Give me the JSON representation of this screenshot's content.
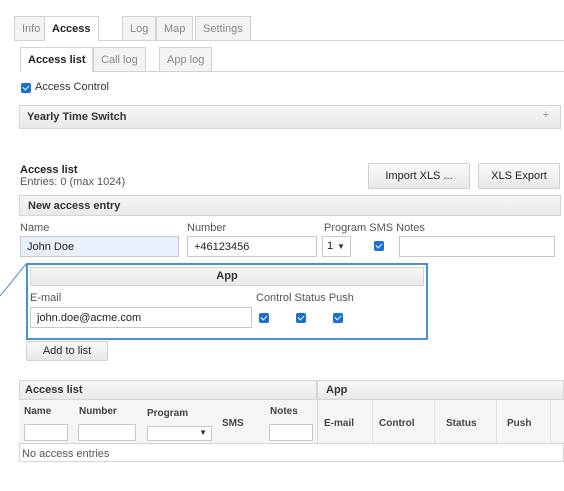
{
  "tabs": [
    {
      "label": "Info"
    },
    {
      "label": "Access"
    },
    {
      "label": "Log"
    },
    {
      "label": "Map"
    },
    {
      "label": "Settings"
    }
  ],
  "subtabs": [
    {
      "label": "Access list"
    },
    {
      "label": "Call log"
    },
    {
      "label": "App log"
    }
  ],
  "access_control": {
    "label": "Access Control",
    "checked": true
  },
  "yearly_time_switch": {
    "title": "Yearly Time Switch",
    "expand_glyph": "+"
  },
  "access_list_header": {
    "title": "Access list",
    "entries": "Entries: 0 (max 1024)"
  },
  "buttons": {
    "import": "Import XLS ...",
    "export": "XLS Export",
    "add": "Add to list"
  },
  "new_entry": {
    "title": "New access entry",
    "labels": {
      "name": "Name",
      "number": "Number",
      "program_sms_notes": "Program SMS Notes"
    },
    "values": {
      "name": "John Doe",
      "number": "+46123456",
      "program": "1",
      "notes": ""
    },
    "sms_checked": true
  },
  "app_section": {
    "title": "App",
    "labels": {
      "email": "E-mail",
      "control_status_push": "Control Status Push"
    },
    "values": {
      "email": "john.doe@acme.com"
    },
    "checks": {
      "control": true,
      "status": true,
      "push": true
    }
  },
  "table": {
    "group_headers": {
      "access_list": "Access list",
      "app": "App"
    },
    "columns": {
      "name": "Name",
      "number": "Number",
      "program": "Program",
      "sms": "SMS",
      "notes": "Notes",
      "email": "E-mail",
      "control": "Control",
      "status": "Status",
      "push": "Push"
    },
    "empty_text": "No access entries"
  },
  "colors": {
    "checkbox": "#1a6fd1",
    "highlight_border": "#4a90d9",
    "name_field_bg": "#e8f0fe"
  },
  "icons": {
    "dropdown": "chevron-down-icon",
    "checkbox": "check-icon"
  }
}
